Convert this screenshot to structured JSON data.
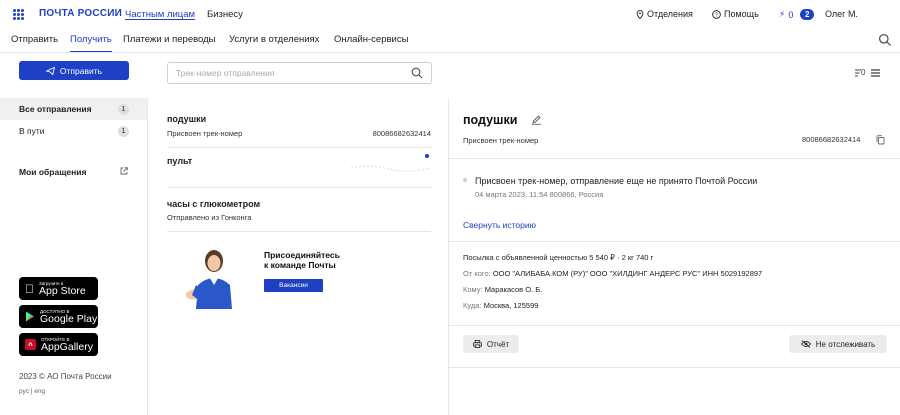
{
  "header": {
    "logo": "ПОЧТА РОССИИ",
    "links": [
      "Частным лицам",
      "Бизнесу"
    ],
    "offices": "Отделения",
    "help": "Помощь",
    "bolt_count": "0",
    "notif_count": "2",
    "user": "Олег М."
  },
  "nav": {
    "items": [
      "Отправить",
      "Получить",
      "Платежи и переводы",
      "Услуги в отделениях",
      "Онлайн-сервисы"
    ]
  },
  "sidebar": {
    "send_button": "Отправить",
    "items": [
      {
        "label": "Все отправления",
        "count": "1"
      },
      {
        "label": "В пути",
        "count": "1"
      }
    ],
    "appeals": "Мои обращения",
    "stores": [
      {
        "small": "Загрузите в",
        "big": "App Store"
      },
      {
        "small": "ДОСТУПНО В",
        "big": "Google Play"
      },
      {
        "small": "ОТКРОЙТЕ В",
        "big": "AppGallery"
      }
    ],
    "copyright": "2023 © АО Почта России",
    "langs": "рус | eng"
  },
  "search": {
    "placeholder": "Трек-номер отправления",
    "filter_count": "0"
  },
  "shipments": [
    {
      "title": "подушки",
      "status": "Присвоен трек-номер",
      "number": "80086682632414"
    },
    {
      "title": "пульт",
      "status": "",
      "number": ""
    },
    {
      "title": "часы с глюкометром",
      "status": "Отправлено из Гонконга",
      "number": ""
    }
  ],
  "promo": {
    "line1": "Присоединяйтесь",
    "line2": "к команде Почты",
    "button": "Вакансии"
  },
  "detail": {
    "title": "подушки",
    "status": "Присвоен трек-номер",
    "number": "80086682632414",
    "event_text": "Присвоен трек-номер, отправление еще не принято Почтой России",
    "event_date": "04 марта 2023, 11:54 800866, Россия",
    "collapse": "Свернуть историю",
    "parcel": "Посылка с объявленной ценностью 5 540 ₽  ·  2 кг 740 г",
    "from_label": "От кого:",
    "from": "ООО \"АЛИБАБА.КОМ (РУ)\" ООО \"ХИЛДИНГ АНДЕРС РУС\" ИНН 5029192897",
    "to_label": "Кому:",
    "to": "Маракасов О. Б.",
    "where_label": "Куда:",
    "where": "Москва, 125599",
    "report_button": "Отчёт",
    "untrack_button": "Не отслеживать"
  }
}
